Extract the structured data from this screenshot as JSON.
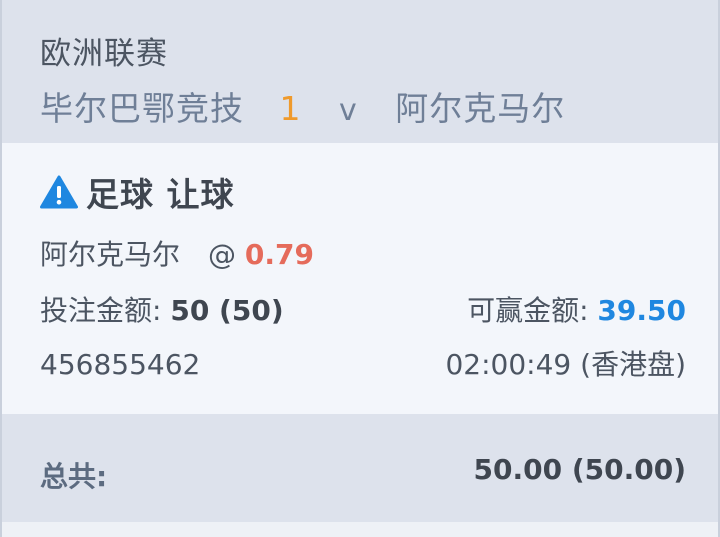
{
  "match": {
    "league": "欧洲联赛",
    "home_team": "毕尔巴鄂竞技",
    "handicap": "1",
    "vs": "v",
    "away_team": "阿尔克马尔"
  },
  "bet": {
    "icon": "warning-icon",
    "title": "足球 让球",
    "selection": "阿尔克马尔",
    "odds_at": "@",
    "odds": "0.79",
    "stake_label": "投注金额:",
    "stake_value": "50 (50)",
    "win_label": "可赢金额:",
    "win_value": "39.50",
    "ticket_id": "456855462",
    "time_odds_type": "02:00:49 (香港盘)"
  },
  "total": {
    "label": "总共:",
    "value": "50.00 (50.00)"
  },
  "colors": {
    "header_bg": "#dde2ec",
    "card_bg": "#f3f6fb",
    "handicap": "#ef9a2c",
    "odds": "#e56b5b",
    "win": "#1f87e0",
    "warning_icon": "#1f87e0"
  }
}
